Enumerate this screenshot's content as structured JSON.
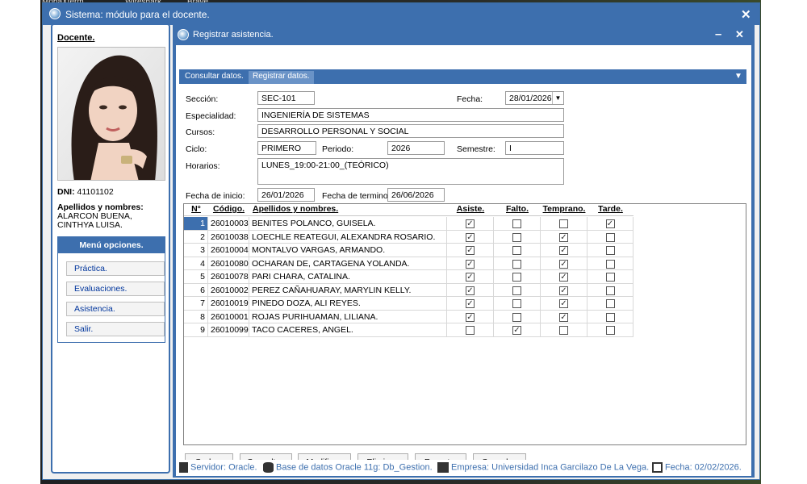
{
  "desktop": {
    "taskbar_labels": [
      "MobaXterm",
      "Wireshark",
      "Brave"
    ]
  },
  "window": {
    "title": "Sistema: módulo para el docente.",
    "close": "✕"
  },
  "sidebar": {
    "docente_label": "Docente.",
    "dni_label": "DNI:",
    "dni_value": "41101102",
    "names_label": "Apellidos y nombres:",
    "names_line1": "ALARCON BUENA,",
    "names_line2": "CINTHYA LUISA.",
    "menu_title": "Menú opciones.",
    "menu_items": [
      "Práctica.",
      "Evaluaciones.",
      "Asistencia.",
      "Salir."
    ]
  },
  "inner": {
    "title": "Registrar asistencia.",
    "minimize": "–",
    "close": "✕",
    "tabs": [
      "Consultar datos.",
      "Registrar datos."
    ],
    "tab_dropdown": "▼"
  },
  "form": {
    "seccion_label": "Sección:",
    "seccion": "SEC-101",
    "fecha_label": "Fecha:",
    "fecha": "28/01/2026",
    "especialidad_label": "Especialidad:",
    "especialidad": "INGENIERÍA DE SISTEMAS",
    "cursos_label": "Cursos:",
    "cursos": "DESARROLLO PERSONAL Y SOCIAL",
    "ciclo_label": "Ciclo:",
    "ciclo": "PRIMERO",
    "periodo_label": "Periodo:",
    "periodo": "2026",
    "semestre_label": "Semestre:",
    "semestre": "I",
    "horarios_label": "Horarios:",
    "horarios": "LUNES_19:00-21:00_(TEÓRICO)",
    "fecha_inicio_label": "Fecha de inicio:",
    "fecha_inicio": "26/01/2026",
    "fecha_termino_label": "Fecha de termino:",
    "fecha_termino": "26/06/2026"
  },
  "table": {
    "headers": [
      "N°",
      "Código.",
      "Apellidos y nombres.",
      "Asiste.",
      "Falto.",
      "Temprano.",
      "Tarde."
    ],
    "rows": [
      {
        "n": "1",
        "codigo": "26010003",
        "nombre": "BENITES POLANCO, GUISELA.",
        "asiste": true,
        "falto": false,
        "temprano": false,
        "tarde": true
      },
      {
        "n": "2",
        "codigo": "26010038",
        "nombre": "LOECHLE REATEGUI, ALEXANDRA ROSARIO.",
        "asiste": true,
        "falto": false,
        "temprano": true,
        "tarde": false
      },
      {
        "n": "3",
        "codigo": "26010004",
        "nombre": "MONTALVO VARGAS, ARMANDO.",
        "asiste": true,
        "falto": false,
        "temprano": true,
        "tarde": false
      },
      {
        "n": "4",
        "codigo": "26010080",
        "nombre": "OCHARAN DE, CARTAGENA YOLANDA.",
        "asiste": true,
        "falto": false,
        "temprano": true,
        "tarde": false
      },
      {
        "n": "5",
        "codigo": "26010078",
        "nombre": "PARI CHARA, CATALINA.",
        "asiste": true,
        "falto": false,
        "temprano": true,
        "tarde": false
      },
      {
        "n": "6",
        "codigo": "26010002",
        "nombre": "PEREZ CAÑAHUARAY, MARYLIN KELLY.",
        "asiste": true,
        "falto": false,
        "temprano": true,
        "tarde": false
      },
      {
        "n": "7",
        "codigo": "26010019",
        "nombre": "PINEDO DOZA, ALI REYES.",
        "asiste": true,
        "falto": false,
        "temprano": true,
        "tarde": false
      },
      {
        "n": "8",
        "codigo": "26010001",
        "nombre": "ROJAS PURIHUAMAN, LILIANA.",
        "asiste": true,
        "falto": false,
        "temprano": true,
        "tarde": false
      },
      {
        "n": "9",
        "codigo": "26010099",
        "nombre": "TACO CACERES, ANGEL.",
        "asiste": false,
        "falto": true,
        "temprano": false,
        "tarde": false
      }
    ]
  },
  "buttons": [
    "Grabar.",
    "Consultar.",
    "Modificar.",
    "Eliminar.",
    "Reporte.",
    "Cancelar."
  ],
  "status": {
    "servidor": "Servidor: Oracle.",
    "base": "Base de datos Oracle 11g: Db_Gestion.",
    "empresa": "Empresa: Universidad Inca Garcilazo De La Vega.",
    "fecha": "Fecha: 02/02/2026."
  },
  "colors": {
    "accent": "#3d6fae",
    "mnemonic": "#d01010",
    "link": "#00359c"
  }
}
